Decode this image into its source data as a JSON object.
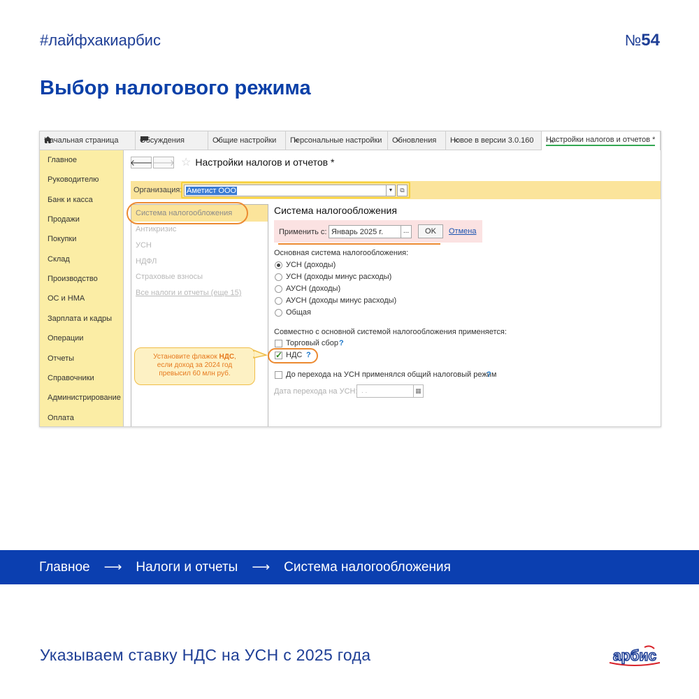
{
  "header": {
    "hashtag": "#лайфхакиарбис",
    "issue_prefix": "№",
    "issue_number": "54",
    "title": "Выбор налогового режима"
  },
  "tabs": [
    {
      "label": "Начальная страница",
      "icon": "home-icon",
      "closable": false
    },
    {
      "label": "Обсуждения",
      "icon": "chat-icon",
      "closable": false
    },
    {
      "label": "Общие настройки",
      "closable": true
    },
    {
      "label": "Персональные настройки",
      "closable": true
    },
    {
      "label": "Обновления",
      "closable": true
    },
    {
      "label": "Новое в версии 3.0.160",
      "closable": true
    },
    {
      "label": "Настройки налогов и отчетов *",
      "closable": true,
      "active": true
    }
  ],
  "sidebar": {
    "items": [
      "Главное",
      "Руководителю",
      "Банк и касса",
      "Продажи",
      "Покупки",
      "Склад",
      "Производство",
      "ОС и НМА",
      "Зарплата и кадры",
      "Операции",
      "Отчеты",
      "Справочники",
      "Администрирование",
      "Оплата"
    ]
  },
  "form": {
    "title": "Настройки налогов и отчетов *",
    "org_label": "Организация:",
    "org_value": "Аметист ООО"
  },
  "left_list": {
    "items": [
      {
        "label": "Система налогообложения",
        "selected": true
      },
      {
        "label": "Антикризис"
      },
      {
        "label": "УСН"
      },
      {
        "label": "НДФЛ"
      },
      {
        "label": "Страховые взносы"
      },
      {
        "label": "Все налоги и отчеты (еще 15)",
        "link": true
      }
    ]
  },
  "section": {
    "title": "Система налогообложения",
    "apply_label": "Применить с:",
    "apply_value": "Январь 2025 г.",
    "apply_dots": "...",
    "ok_label": "OK",
    "cancel_label": "Отмена",
    "main_system_label": "Основная система налогообложения:",
    "radios": [
      {
        "label": "УСН (доходы)",
        "checked": true
      },
      {
        "label": "УСН (доходы минус расходы)",
        "checked": false
      },
      {
        "label": "АУСН (доходы)",
        "checked": false
      },
      {
        "label": "АУСН (доходы минус расходы)",
        "checked": false
      },
      {
        "label": "Общая",
        "checked": false
      }
    ],
    "joint_label": "Совместно с основной системой налогообложения применяется:",
    "trade_fee_label": "Торговый сбор",
    "vat_label": "НДС",
    "before_usn_label": "До перехода на УСН применялся общий налоговый режим",
    "transition_date_label": "Дата перехода на УСН:",
    "transition_date_placeholder": ". .",
    "help_mark": "?"
  },
  "callout": {
    "line1_prefix": "Установите флажок ",
    "line1_bold": "НДС",
    "line1_suffix": ",",
    "line2": "если доход за 2024 год",
    "line3": "превысил 60 млн руб."
  },
  "path": {
    "items": [
      "Главное",
      "Налоги и отчеты",
      "Система налогообложения"
    ],
    "separator": "⟶"
  },
  "footer": {
    "text": "Указываем ставку НДС на УСН с 2025 года",
    "logo_text": "арбис"
  },
  "colors": {
    "brand_blue": "#0b3fb0",
    "sidebar_yellow": "#fbeda5",
    "highlight_orange": "#ec8a31"
  }
}
